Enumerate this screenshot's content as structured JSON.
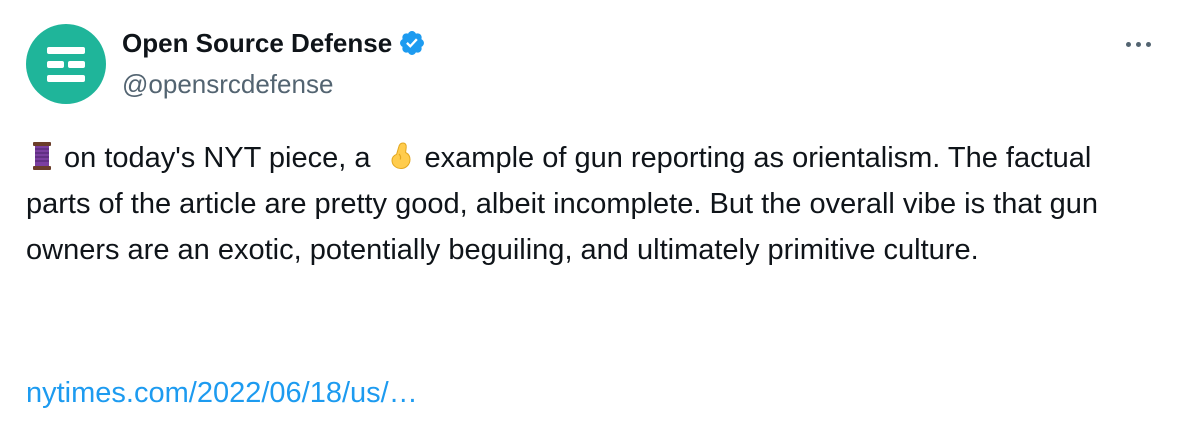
{
  "author": {
    "display_name": "Open Source Defense",
    "handle": "@opensrcdefense",
    "verified_icon": "verified-badge-icon",
    "avatar_icon": "open-source-defense-logo",
    "avatar_color": "#1fb59a"
  },
  "menu": {
    "icon": "more-horizontal-icon"
  },
  "tweet": {
    "emoji_1": "thread-spool-emoji",
    "text_part1": "on today's NYT piece, a",
    "emoji_2": "pinching-hand-emoji",
    "text_part2": "example of gun reporting as orientalism. The factual parts of the article are pretty good, albeit incomplete. But the overall vibe is that gun owners are an exotic, potentially beguiling, and ultimately primitive culture.",
    "link": "nytimes.com/2022/06/18/us/…"
  },
  "colors": {
    "text": "#0f1419",
    "secondary": "#536471",
    "link": "#1d9bf0",
    "verified": "#1d9bf0"
  }
}
